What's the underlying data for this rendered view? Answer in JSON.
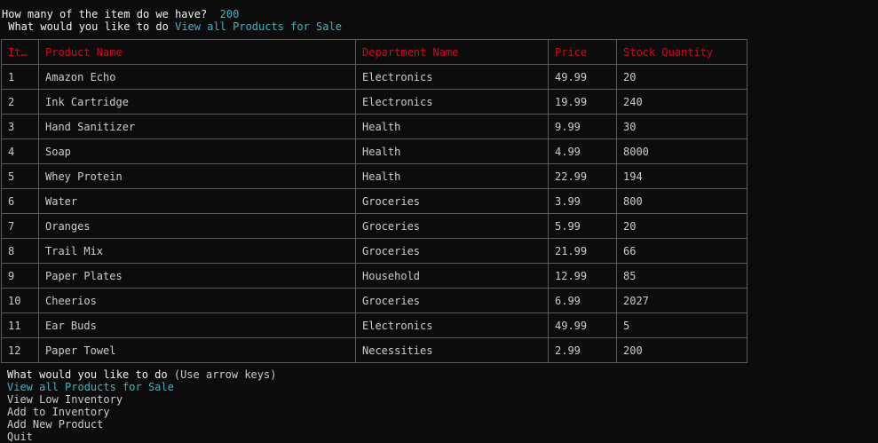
{
  "prompt": {
    "question": "How many of the item do we have?",
    "answer": "200"
  },
  "previous_question": {
    "label": "What would you like to do",
    "answer": "View all Products for Sale"
  },
  "table": {
    "headers": [
      "It…",
      "Product Name",
      "Department Name",
      "Price",
      "Stock Quantity"
    ],
    "rows": [
      [
        "1",
        "Amazon Echo",
        "Electronics",
        "49.99",
        "20"
      ],
      [
        "2",
        "Ink Cartridge",
        "Electronics",
        "19.99",
        "240"
      ],
      [
        "3",
        "Hand Sanitizer",
        "Health",
        "9.99",
        "30"
      ],
      [
        "4",
        "Soap",
        "Health",
        "4.99",
        "8000"
      ],
      [
        "5",
        "Whey Protein",
        "Health",
        "22.99",
        "194"
      ],
      [
        "6",
        "Water",
        "Groceries",
        "3.99",
        "800"
      ],
      [
        "7",
        "Oranges",
        "Groceries",
        "5.99",
        "20"
      ],
      [
        "8",
        "Trail Mix",
        "Groceries",
        "21.99",
        "66"
      ],
      [
        "9",
        "Paper Plates",
        "Household",
        "12.99",
        "85"
      ],
      [
        "10",
        "Cheerios",
        "Groceries",
        "6.99",
        "2027"
      ],
      [
        "11",
        "Ear Buds",
        "Electronics",
        "49.99",
        "5"
      ],
      [
        "12",
        "Paper Towel",
        "Necessities",
        "2.99",
        "200"
      ]
    ]
  },
  "menu": {
    "question": "What would you like to do",
    "hint": "(Use arrow keys)",
    "options": [
      "View all Products for Sale",
      "View Low Inventory",
      "Add to Inventory",
      "Add New Product",
      "Quit"
    ],
    "selected_index": 0
  },
  "colors": {
    "background": "#0c0c0c",
    "text": "#cccccc",
    "bright_text": "#f2f2f2",
    "accent_cyan": "#3ab7c8",
    "header_red": "#c50f1f",
    "border": "#5a5a5a"
  }
}
